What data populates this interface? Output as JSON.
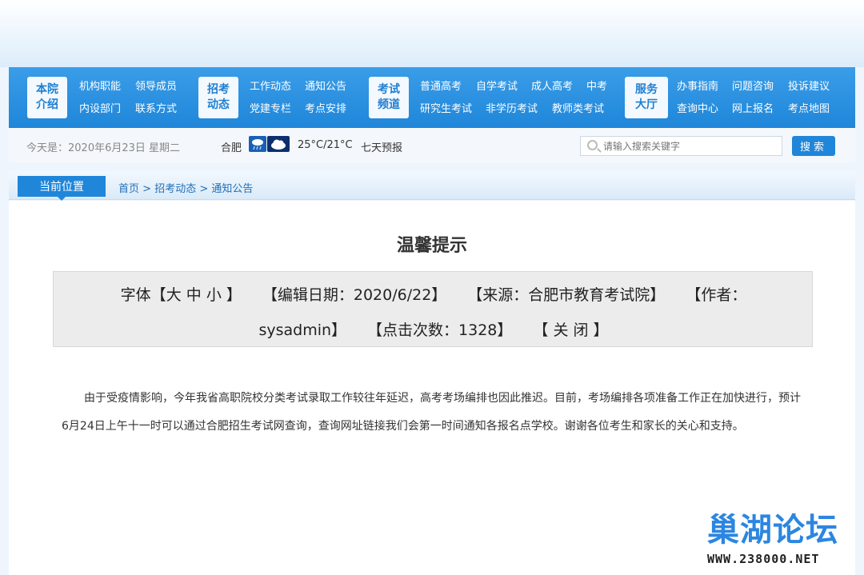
{
  "nav": {
    "groups": [
      {
        "tile": [
          "本院",
          "介绍"
        ],
        "links": [
          [
            "机构职能",
            "领导成员"
          ],
          [
            "内设部门",
            "联系方式"
          ]
        ]
      },
      {
        "tile": [
          "招考",
          "动态"
        ],
        "links": [
          [
            "工作动态",
            "通知公告"
          ],
          [
            "党建专栏",
            "考点安排"
          ]
        ]
      },
      {
        "tile": [
          "考试",
          "频道"
        ],
        "links": [
          [
            "普通高考",
            "自学考试",
            "成人高考",
            "中考"
          ],
          [
            "研究生考试",
            "非学历考试",
            "教师类考试"
          ]
        ]
      },
      {
        "tile": [
          "服务",
          "大厅"
        ],
        "links": [
          [
            "办事指南",
            "问题咨询",
            "投诉建议"
          ],
          [
            "查询中心",
            "网上报名",
            "考点地图"
          ]
        ]
      }
    ]
  },
  "info": {
    "today": "今天是：2020年6月23日 星期二",
    "city": "合肥",
    "temperature": "25°C/21°C",
    "forecast": "七天预报",
    "weather_icons": [
      "rain-icon",
      "cloudy-icon"
    ]
  },
  "search": {
    "placeholder": "请输入搜索关键字",
    "button": "搜索"
  },
  "breadcrumb": {
    "label": "当前位置",
    "path": [
      "首页",
      "招考动态",
      "通知公告"
    ],
    "separator": ">"
  },
  "article": {
    "title": "温馨提示",
    "font_label": "字体【",
    "font_sizes": [
      "大",
      "中",
      "小"
    ],
    "font_close": " 】",
    "edit_date": "【编辑日期：2020/6/22】",
    "source": "【来源：合肥市教育考试院】",
    "author_prefix": "【作者：",
    "author": "sysadmin】",
    "hits": "【点击次数：1328】",
    "close": "【 关 闭 】",
    "body": "由于受疫情影响，今年我省高职院校分类考试录取工作较往年延迟，高考考场编排也因此推迟。目前，考场编排各项准备工作正在加快进行，预计6月24日上午十一时可以通过合肥招生考试网查询，查询网址链接我们会第一时间通知各报名点学校。谢谢各位考生和家长的关心和支持。"
  },
  "watermark": {
    "title": "巢湖论坛",
    "url": "WWW.238000.NET"
  },
  "colors": {
    "nav_blue": "#1f86d9",
    "tile_text": "#1f7fd0",
    "link_blue": "#1f6fb8",
    "watermark_blue": "#2c86e0"
  }
}
